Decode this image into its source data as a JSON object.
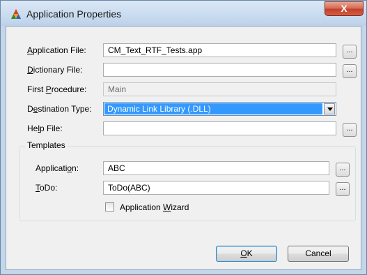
{
  "window": {
    "title": "Application Properties",
    "close_glyph": "X"
  },
  "fields": {
    "application_file": {
      "label_pre": "",
      "label_key": "A",
      "label_post": "pplication File:",
      "value": "CM_Text_RTF_Tests.app"
    },
    "dictionary_file": {
      "label_pre": "",
      "label_key": "D",
      "label_post": "ictionary File:",
      "value": ""
    },
    "first_procedure": {
      "label_pre": "First ",
      "label_key": "P",
      "label_post": "rocedure:",
      "value": "Main"
    },
    "destination_type": {
      "label_pre": "D",
      "label_key": "e",
      "label_post": "stination Type:",
      "value": "Dynamic Link Library (.DLL)"
    },
    "help_file": {
      "label_pre": "He",
      "label_key": "l",
      "label_post": "p File:",
      "value": ""
    }
  },
  "templates": {
    "group_title": "Templates",
    "application": {
      "label_pre": "Applicati",
      "label_key": "o",
      "label_post": "n:",
      "value": "ABC"
    },
    "todo": {
      "label_pre": "",
      "label_key": "T",
      "label_post": "oDo:",
      "value": "ToDo(ABC)"
    },
    "wizard": {
      "label_pre": "Application ",
      "label_key": "W",
      "label_post": "izard",
      "checked": false
    }
  },
  "buttons": {
    "browse_label": "...",
    "ok_key": "O",
    "ok_post": "K",
    "cancel_label": "Cancel"
  },
  "colors": {
    "selection": "#3399ff",
    "close_button": "#c2402a"
  }
}
